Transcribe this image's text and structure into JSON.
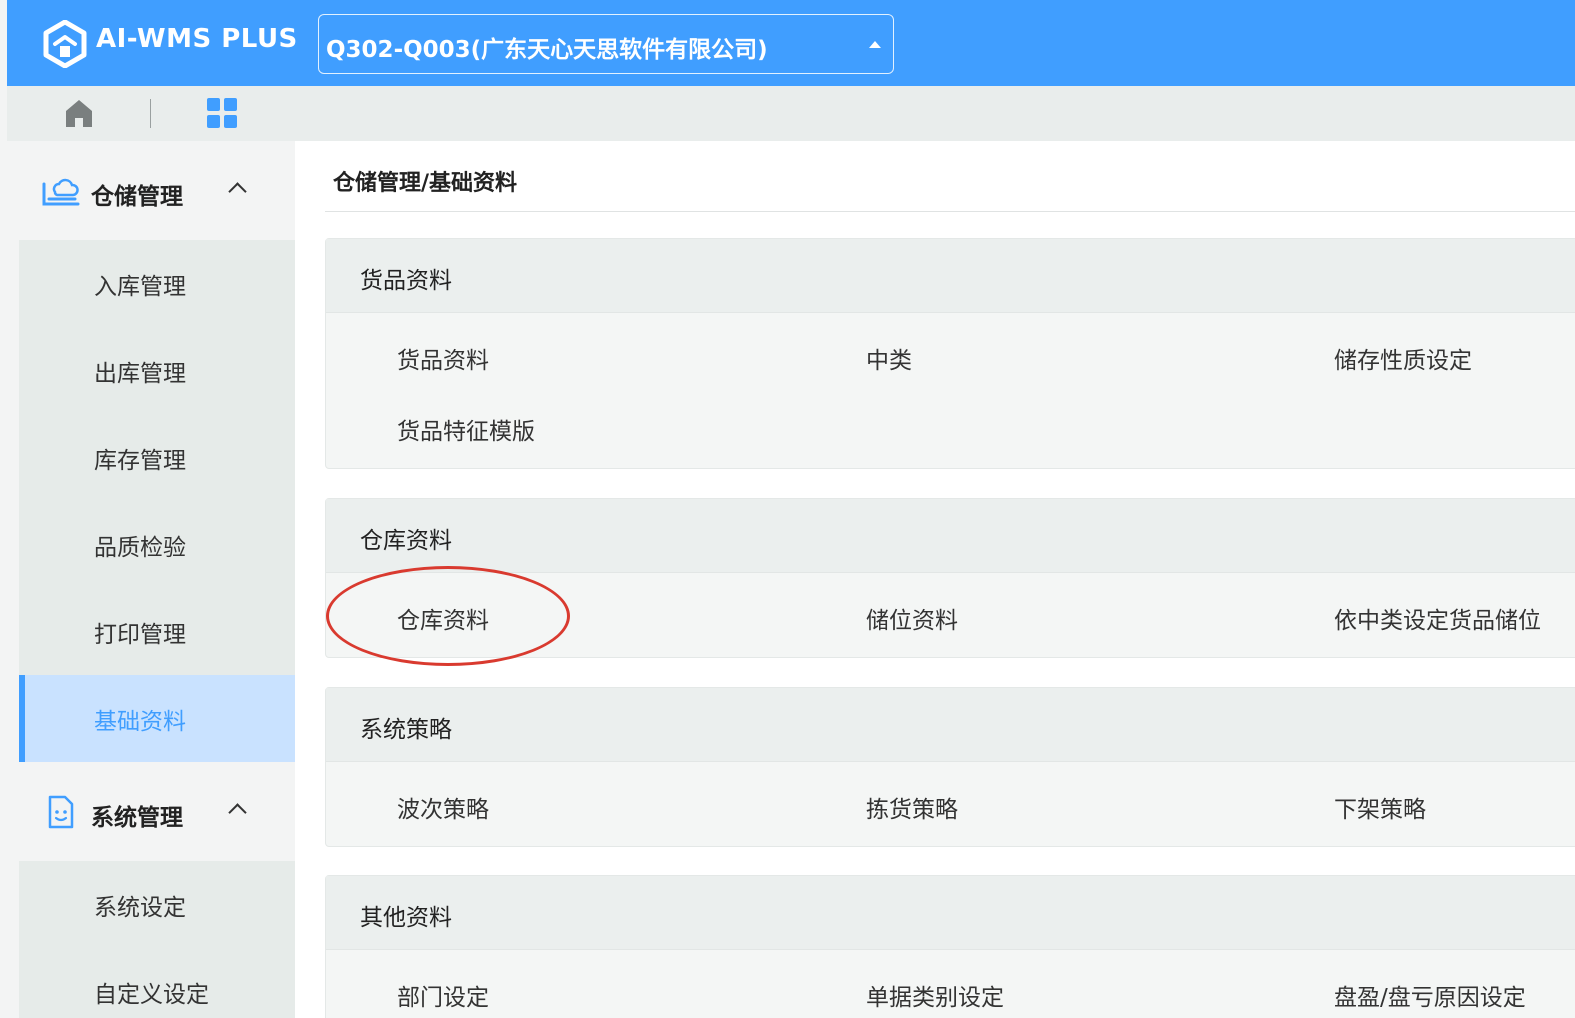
{
  "app": {
    "title": "AI-WMS PLUS",
    "org_selector": "Q302-Q003(广东天心天思软件有限公司)"
  },
  "icons": {
    "logo": "house-logo-icon",
    "home": "home-icon",
    "apps": "grid-icon",
    "warehouse": "warehouse-cloud-icon",
    "system": "document-face-icon",
    "expand": "chevron-up-icon"
  },
  "colors": {
    "brand": "#409eff",
    "active_bg": "#c9e2ff",
    "highlight": "#d93a2f"
  },
  "sidebar": {
    "groups": [
      {
        "title": "仓储管理",
        "items": [
          "入库管理",
          "出库管理",
          "库存管理",
          "品质检验",
          "打印管理",
          "基础资料"
        ],
        "active": "基础资料"
      },
      {
        "title": "系统管理",
        "items": [
          "系统设定",
          "自定义设定"
        ]
      }
    ]
  },
  "main": {
    "breadcrumb": "仓储管理/基础资料",
    "sections": [
      {
        "title": "货品资料",
        "links": [
          "货品资料",
          "中类",
          "储存性质设定",
          "货品特征模版"
        ]
      },
      {
        "title": "仓库资料",
        "links": [
          "仓库资料",
          "储位资料",
          "依中类设定货品储位"
        ]
      },
      {
        "title": "系统策略",
        "links": [
          "波次策略",
          "拣货策略",
          "下架策略"
        ]
      },
      {
        "title": "其他资料",
        "links": [
          "部门设定",
          "单据类别设定",
          "盘盈/盘亏原因设定"
        ]
      }
    ]
  }
}
